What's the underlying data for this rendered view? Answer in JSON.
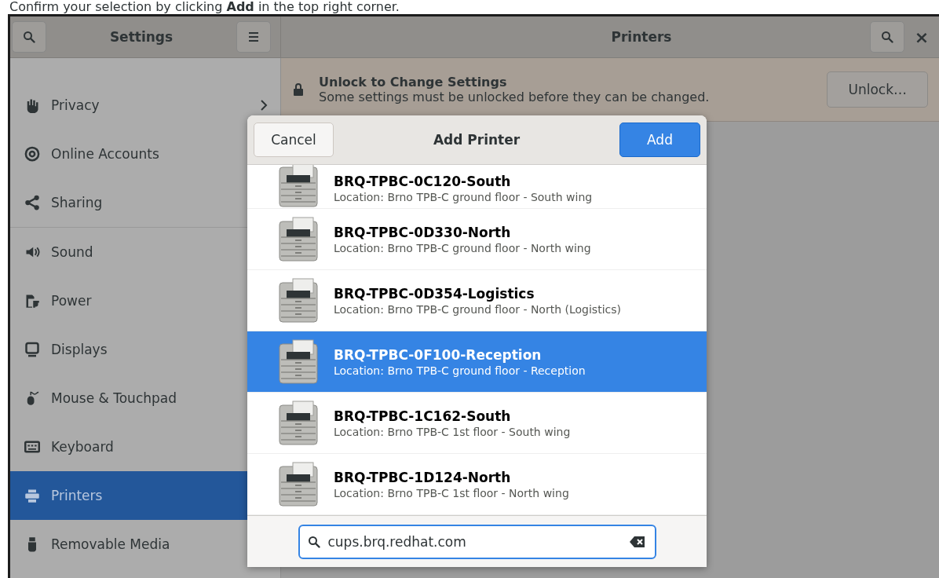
{
  "caption": "Confirm your selection by clicking **Add** in the top right corner.",
  "sidebar": {
    "title": "Settings",
    "groups": [
      [
        {
          "label": "Privacy",
          "kind": "submenu",
          "selected": false
        },
        {
          "label": "Online Accounts",
          "kind": "panel",
          "selected": false
        },
        {
          "label": "Sharing",
          "kind": "panel",
          "selected": false
        }
      ],
      [
        {
          "label": "Sound",
          "kind": "panel",
          "selected": false
        },
        {
          "label": "Power",
          "kind": "panel",
          "selected": false
        },
        {
          "label": "Displays",
          "kind": "panel",
          "selected": false
        },
        {
          "label": "Mouse & Touchpad",
          "kind": "panel",
          "selected": false
        },
        {
          "label": "Keyboard",
          "kind": "panel",
          "selected": false
        },
        {
          "label": "Printers",
          "kind": "panel",
          "selected": true
        },
        {
          "label": "Removable Media",
          "kind": "panel",
          "selected": false
        }
      ]
    ]
  },
  "main": {
    "title": "Printers",
    "close": "×",
    "banner": {
      "title": "Unlock to Change Settings",
      "text": "Some settings must be unlocked before they can be changed.",
      "button": "Unlock…"
    }
  },
  "dialog": {
    "title": "Add Printer",
    "cancel": "Cancel",
    "confirm": "Add",
    "printers": [
      {
        "name": "BRQ-TPBC-0C120-South",
        "location": "Location: Brno TPB-C ground floor - South wing",
        "selected": false
      },
      {
        "name": "BRQ-TPBC-0D330-North",
        "location": "Location: Brno TPB-C ground floor - North wing",
        "selected": false
      },
      {
        "name": "BRQ-TPBC-0D354-Logistics",
        "location": "Location: Brno TPB-C ground floor - North (Logistics)",
        "selected": false
      },
      {
        "name": "BRQ-TPBC-0F100-Reception",
        "location": "Location: Brno TPB-C ground floor - Reception",
        "selected": true
      },
      {
        "name": "BRQ-TPBC-1C162-South",
        "location": "Location: Brno TPB-C 1st floor - South wing",
        "selected": false
      },
      {
        "name": "BRQ-TPBC-1D124-North",
        "location": "Location: Brno TPB-C 1st floor - North wing",
        "selected": false
      }
    ],
    "search": {
      "value": "cups.brq.redhat.com"
    }
  }
}
